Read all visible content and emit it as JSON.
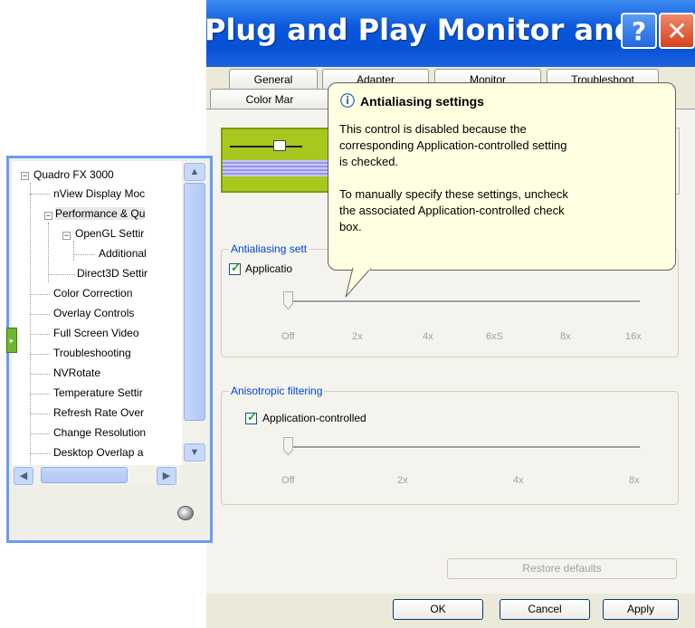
{
  "window": {
    "title": "Plug and Play Monitor and ...",
    "help_glyph": "?",
    "close_glyph": "✕"
  },
  "tabs_row1": [
    {
      "label": "General"
    },
    {
      "label": "Adapter"
    },
    {
      "label": "Monitor"
    },
    {
      "label": "Troubleshoot"
    }
  ],
  "tabs_row2": [
    {
      "label": "Color Mar",
      "selected": false
    },
    {
      "label": "",
      "selected": true
    }
  ],
  "antialiasing": {
    "legend": "Antialiasing sett",
    "checkbox_label": "Applicatio",
    "checked": true,
    "ticks": [
      "Off",
      "2x",
      "4x",
      "6xS",
      "8x",
      "16x"
    ]
  },
  "anisotropic": {
    "legend": "Anisotropic filtering",
    "checkbox_label": "Application-controlled",
    "checked": true,
    "ticks": [
      "Off",
      "2x",
      "4x",
      "8x"
    ]
  },
  "buttons": {
    "restore_defaults": "Restore defaults",
    "ok": "OK",
    "cancel": "Cancel",
    "apply": "Apply"
  },
  "balloon": {
    "title": "Antialiasing settings",
    "line1": "This control is disabled because the",
    "line2": "corresponding Application-controlled setting",
    "line3": "is checked.",
    "line4": "To manually specify these settings, uncheck",
    "line5": "the associated Application-controlled check",
    "line6": "box."
  },
  "tree": {
    "items": [
      {
        "label": "Quadro FX 3000"
      },
      {
        "label": "nView Display Moc"
      },
      {
        "label": "Performance & Qu"
      },
      {
        "label": "OpenGL Settir"
      },
      {
        "label": "Additional"
      },
      {
        "label": "Direct3D Settir"
      },
      {
        "label": "Color Correction"
      },
      {
        "label": "Overlay Controls"
      },
      {
        "label": "Full Screen Video"
      },
      {
        "label": "Troubleshooting"
      },
      {
        "label": "NVRotate"
      },
      {
        "label": "Temperature Settir"
      },
      {
        "label": "Refresh Rate Over"
      },
      {
        "label": "Change Resolution"
      },
      {
        "label": "Desktop Overlap a"
      }
    ]
  },
  "colors": {
    "accent": "#0046d5",
    "titlebar": "#0a58dc",
    "tree_border": "#6a9cf0"
  }
}
